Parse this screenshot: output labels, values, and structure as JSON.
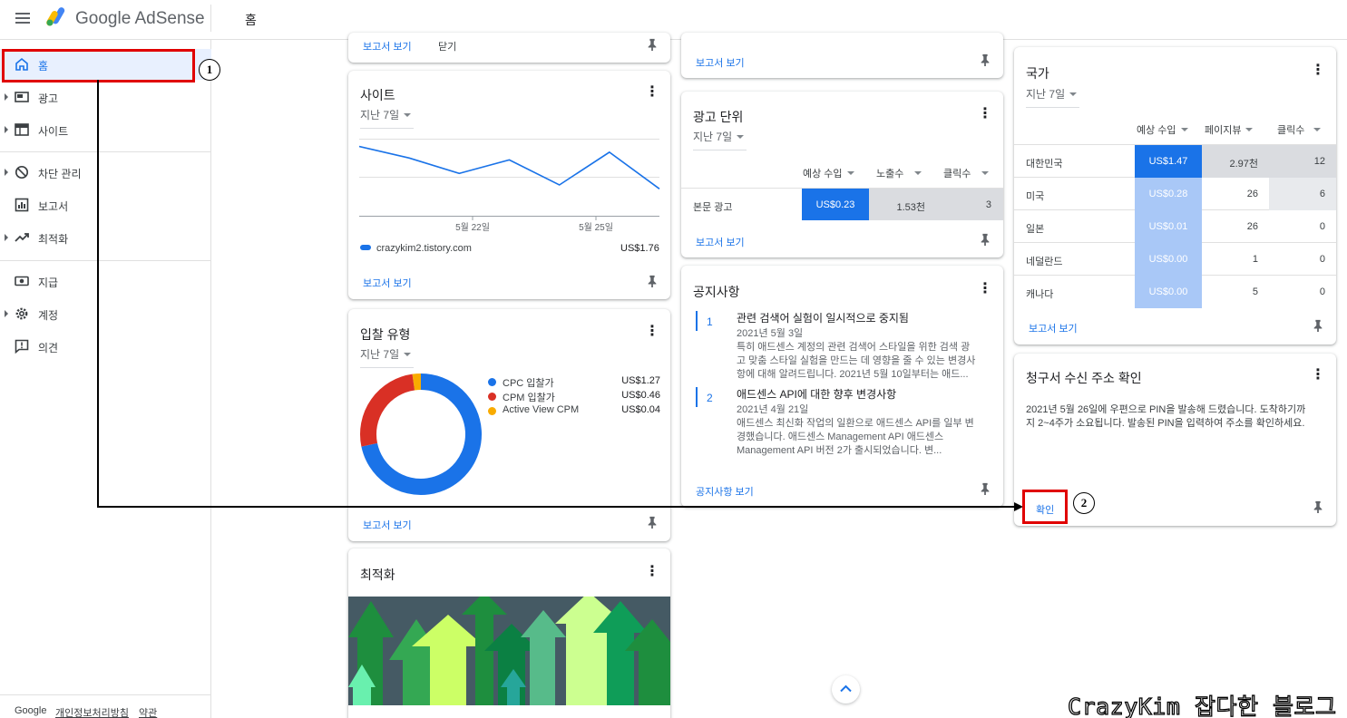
{
  "header": {
    "product": "Google AdSense",
    "page_title": "홈"
  },
  "sidebar": {
    "items": [
      {
        "label": "홈"
      },
      {
        "label": "광고"
      },
      {
        "label": "사이트"
      },
      {
        "label": "차단 관리"
      },
      {
        "label": "보고서"
      },
      {
        "label": "최적화"
      },
      {
        "label": "지급"
      },
      {
        "label": "계정"
      },
      {
        "label": "의견"
      }
    ],
    "footer": {
      "google": "Google",
      "privacy": "개인정보처리방침",
      "terms": "약관"
    }
  },
  "common": {
    "report_link": "보고서 보기",
    "close": "닫기",
    "period": "지난 7일"
  },
  "site_card": {
    "title": "사이트",
    "x_labels": [
      "5월 22일",
      "5월 25일"
    ],
    "site": "crazykim2.tistory.com",
    "amount": "US$1.76",
    "chart_data": {
      "type": "line",
      "series": [
        {
          "values": [
            0.36,
            0.3,
            0.22,
            0.29,
            0.16,
            0.33,
            0.14
          ]
        }
      ]
    }
  },
  "bid_card": {
    "title": "입찰 유형",
    "legend": [
      {
        "label": "CPC 입찰가",
        "value": "US$1.27",
        "color": "#1a73e8"
      },
      {
        "label": "CPM 입찰가",
        "value": "US$0.46",
        "color": "#d93025"
      },
      {
        "label": "Active View CPM",
        "value": "US$0.04",
        "color": "#f9ab00"
      }
    ],
    "chart_data": {
      "type": "pie",
      "categories": [
        "CPC 입찰가",
        "CPM 입찰가",
        "Active View CPM"
      ],
      "values": [
        1.27,
        0.46,
        0.04
      ]
    }
  },
  "opt_card": {
    "title": "최적화"
  },
  "adunit_card": {
    "title": "광고 단위",
    "columns": [
      "예상 수입",
      "노출수",
      "클릭수"
    ],
    "rows": [
      {
        "name": "본문 광고",
        "earnings": "US$0.23",
        "impressions": "1.53천",
        "clicks": "3"
      }
    ]
  },
  "notice_card": {
    "title": "공지사항",
    "items": [
      {
        "num": "1",
        "title": "관련 검색어 실험이 일시적으로 중지됨",
        "date": "2021년 5월 3일",
        "lines": [
          "특히 애드센스 계정의 관련 검색어 스타일을 위한 검색 광",
          "고 맞춤 스타일 실험을 만드는 데 영향을 줄 수 있는 변경사",
          "항에 대해 알려드립니다. 2021년 5월 10일부터는 애드..."
        ]
      },
      {
        "num": "2",
        "title": "애드센스 API에 대한 향후 변경사항",
        "date": "2021년 4월 21일",
        "lines": [
          "애드센스 최신화 작업의 일환으로 애드센스 API를 일부 변",
          "경했습니다. 애드센스 Management API 애드센스",
          "Management API 버전 2가 출시되었습니다. 변..."
        ]
      }
    ],
    "link": "공지사항 보기"
  },
  "country_card": {
    "title": "국가",
    "columns": [
      "예상 수입",
      "페이지뷰",
      "클릭수"
    ],
    "rows": [
      {
        "name": "대한민국",
        "earnings": "US$1.47",
        "pageviews": "2.97천",
        "clicks": "12"
      },
      {
        "name": "미국",
        "earnings": "US$0.28",
        "pageviews": "26",
        "clicks": "6"
      },
      {
        "name": "일본",
        "earnings": "US$0.01",
        "pageviews": "26",
        "clicks": "0"
      },
      {
        "name": "네덜란드",
        "earnings": "US$0.00",
        "pageviews": "1",
        "clicks": "0"
      },
      {
        "name": "캐나다",
        "earnings": "US$0.00",
        "pageviews": "5",
        "clicks": "0"
      }
    ]
  },
  "billing_card": {
    "title": "청구서 수신 주소 확인",
    "lines": [
      "2021년 5월 26일에 우편으로 PIN을 발송해 드렸습니다. 도착하기까",
      "지 2~4주가 소요됩니다. 발송된 PIN을 입력하여 주소를 확인하세요."
    ],
    "button": "확인"
  },
  "annotations": {
    "n1": "1",
    "n2": "2"
  },
  "watermark": "CrazyKim 잡다한 블로그",
  "colors": {
    "accent": "#1a73e8",
    "highlight": "#e00000"
  }
}
